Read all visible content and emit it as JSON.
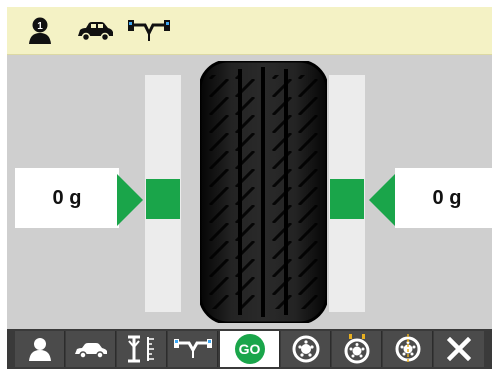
{
  "header": {
    "icons": [
      "operator-1-icon",
      "car-icon",
      "axle-icon"
    ],
    "operator_number": "1"
  },
  "balance": {
    "left_weight": "0 g",
    "right_weight": "0 g"
  },
  "toolbar": {
    "items": [
      {
        "icon": "operator-icon"
      },
      {
        "icon": "car-icon"
      },
      {
        "icon": "rim-dimensions-icon"
      },
      {
        "icon": "axle-icon"
      },
      {
        "icon": "go-icon",
        "label": "GO",
        "active": true
      },
      {
        "icon": "wheel-icon"
      },
      {
        "icon": "wheel-weights-icon"
      },
      {
        "icon": "wheel-center-icon"
      },
      {
        "icon": "close-icon"
      }
    ]
  },
  "colors": {
    "accent": "#1aa54a",
    "header_bg": "#f4f2c5",
    "toolbar_bg": "#3a3a3a",
    "panel_bg": "#cfcfcf"
  }
}
